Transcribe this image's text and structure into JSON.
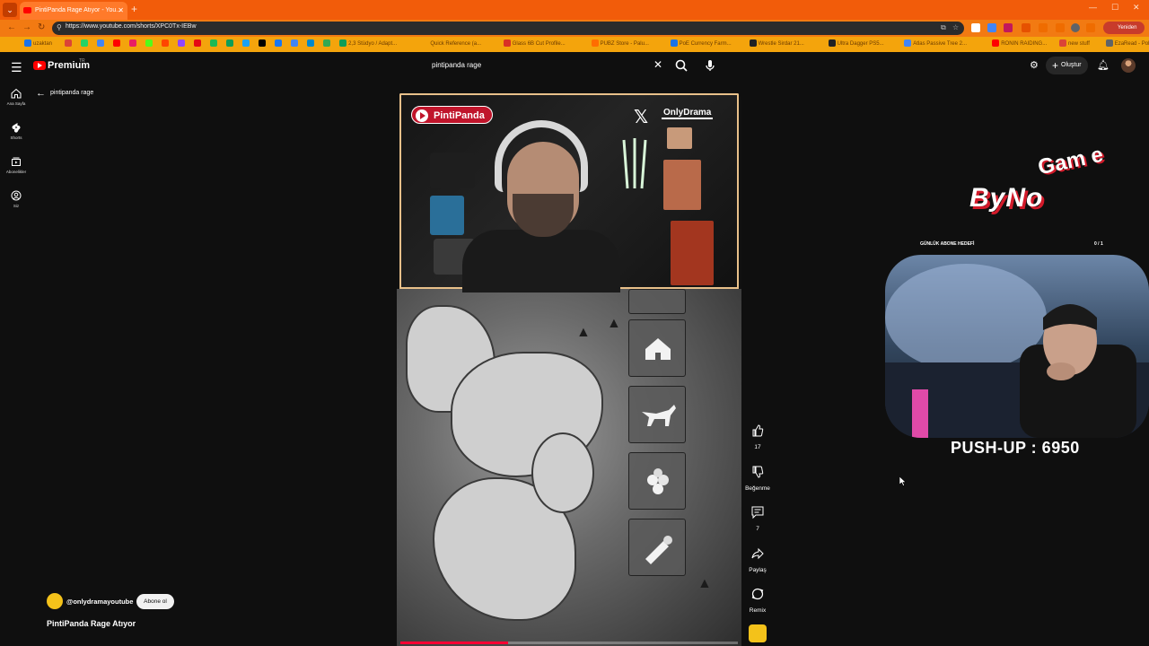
{
  "browser": {
    "tab_title": "PintiPanda Rage Atıyor - You...",
    "url": "https://www.youtube.com/shorts/XPC0Tx-IEBw",
    "profile_label": "Yeniden b..."
  },
  "bookmarks": [
    {
      "label": "uzaktan",
      "color": "#1a73e8"
    },
    {
      "label": "",
      "color": "#db4437"
    },
    {
      "label": "",
      "color": "#25d366"
    },
    {
      "label": "",
      "color": "#4285f4"
    },
    {
      "label": "",
      "color": "#ff0000"
    },
    {
      "label": "",
      "color": "#e91e63"
    },
    {
      "label": "",
      "color": "#53fc18"
    },
    {
      "label": "",
      "color": "#ff4500"
    },
    {
      "label": "",
      "color": "#9146ff"
    },
    {
      "label": "",
      "color": "#e50914"
    },
    {
      "label": "",
      "color": "#1db954"
    },
    {
      "label": "",
      "color": "#0f9d58"
    },
    {
      "label": "",
      "color": "#1da1f2"
    },
    {
      "label": "",
      "color": "#000000"
    },
    {
      "label": "",
      "color": "#1877f2"
    },
    {
      "label": "",
      "color": "#4285f4"
    },
    {
      "label": "",
      "color": "#0088cc"
    },
    {
      "label": "",
      "color": "#34a853"
    },
    {
      "label": "2,3 Stüdyo / Adapt...",
      "color": "#0f9d58"
    },
    {
      "label": "Quick Reference (a...",
      "color": "#f4a40c"
    },
    {
      "label": "Glass 6B Cut Profile...",
      "color": "#d93025"
    },
    {
      "label": "PUBZ Store - Palu...",
      "color": "#ff6d00"
    },
    {
      "label": "PoE Currency Farm...",
      "color": "#1a73e8"
    },
    {
      "label": "Wrestle Sirdar 21...",
      "color": "#202124"
    },
    {
      "label": "Ultra Dagger PS5...",
      "color": "#202124"
    },
    {
      "label": "Atlas Passive Tree 2...",
      "color": "#4285f4"
    },
    {
      "label": "RONIN RAIDING...",
      "color": "#ff0000"
    },
    {
      "label": "new stuff",
      "color": "#db4437"
    },
    {
      "label": "EzaRead - PoE 2...",
      "color": "#5f6368"
    }
  ],
  "youtube": {
    "logo_text": "Premium",
    "logo_region": "TR",
    "search_value": "pintipanda rage",
    "create_label": "Oluştur",
    "guide": [
      {
        "label": "Ana Sayfa",
        "icon": "home-icon"
      },
      {
        "label": "Shorts",
        "icon": "shorts-icon"
      },
      {
        "label": "Abonelikler",
        "icon": "subscriptions-icon"
      },
      {
        "label": "Siz",
        "icon": "you-icon"
      }
    ],
    "back_label": "pintipanda rage"
  },
  "video": {
    "overlay_channel": "PintiPanda",
    "overlay_brand": "OnlyDrama",
    "progress_percent": 32
  },
  "actions": {
    "like_count": "17",
    "dislike_label": "Beğenme",
    "comment_count": "7",
    "share_label": "Paylaş",
    "remix_label": "Remix"
  },
  "channel": {
    "handle": "@onlydramayoutube",
    "subscribe_label": "Abone ol",
    "video_title": "PintiPanda Rage Atıyor"
  },
  "stream_overlay": {
    "logo_main": "ByNo",
    "logo_sub": "Gam e",
    "goal_label": "GÜNLÜK ABONE HEDEFİ",
    "goal_count": "0 / 1",
    "pushup_text": "PUSH-UP : 6950"
  }
}
